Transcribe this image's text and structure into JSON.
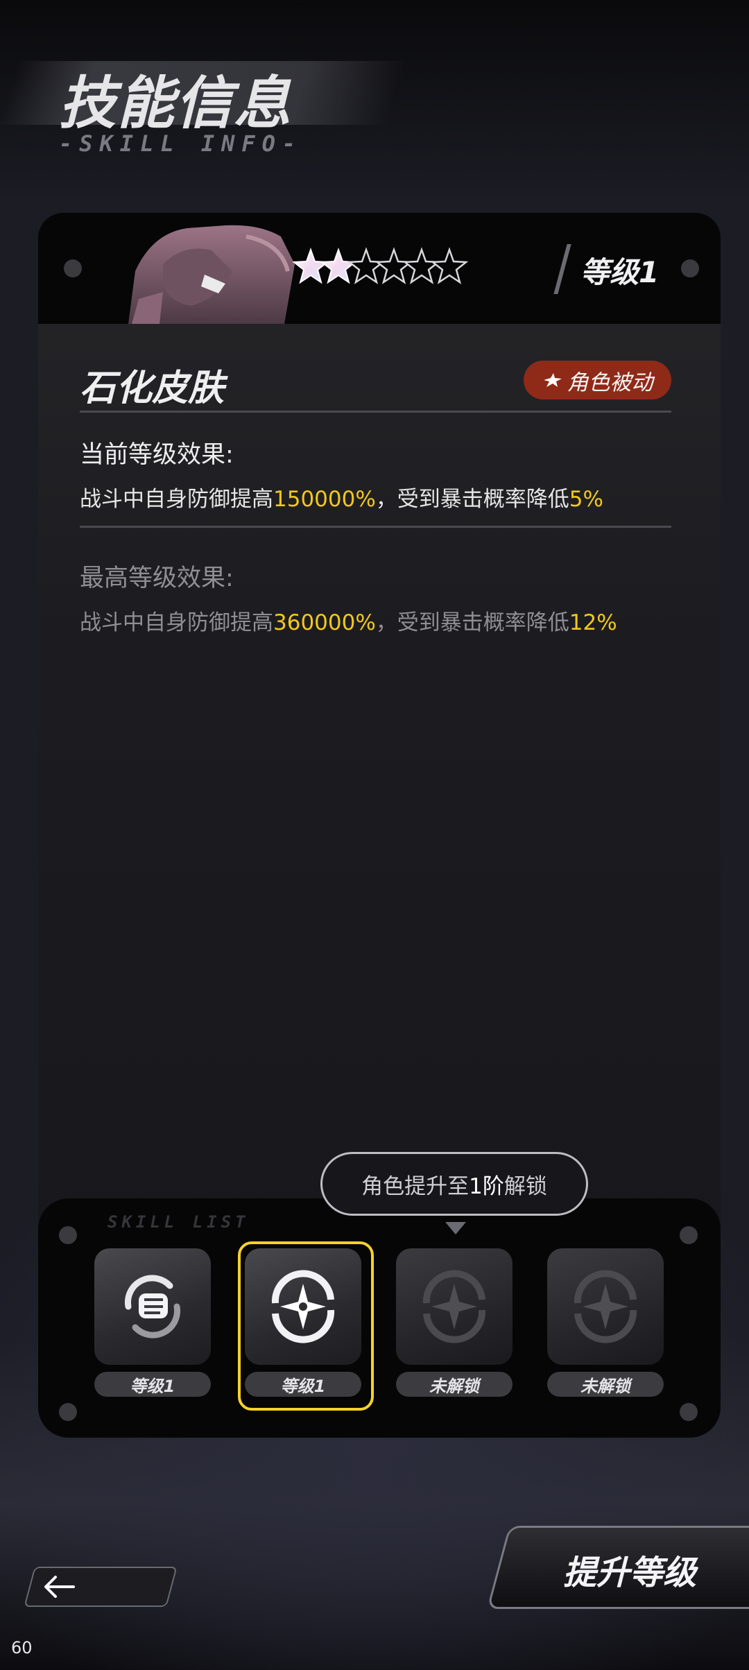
{
  "header": {
    "title": "技能信息",
    "subtitle": "-SKILL INFO-"
  },
  "skill": {
    "level_label": "等级1",
    "stars_filled": 2,
    "stars_total": 6,
    "name": "石化皮肤",
    "type_badge": "角色被动"
  },
  "current_effect": {
    "title": "当前等级效果:",
    "text_before": "战斗中自身防御提高",
    "value1": "150000%",
    "text_middle": "，受到暴击概率降低",
    "value2": "5%"
  },
  "max_effect": {
    "title": "最高等级效果:",
    "text_before": "战斗中自身防御提高",
    "value1": "360000%",
    "text_middle": "，受到暴击概率降低",
    "value2": "12%"
  },
  "unlock_tip": {
    "prefix": "角色提升至",
    "rank": "1阶",
    "suffix": "解锁"
  },
  "panel_label": "SKILL LIST",
  "skill_slots": [
    {
      "label": "等级1",
      "state": "unlocked",
      "icon": "fist-skill-icon"
    },
    {
      "label": "等级1",
      "state": "selected",
      "icon": "star-ring-skill-icon"
    },
    {
      "label": "未解锁",
      "state": "locked",
      "icon": "star-ring-skill-icon"
    },
    {
      "label": "未解锁",
      "state": "locked",
      "icon": "star-ring-skill-icon"
    }
  ],
  "buttons": {
    "upgrade": "提升等级",
    "back_icon": "back-arrow-icon"
  },
  "fps": "60",
  "colors": {
    "highlight": "#f2c81c",
    "badge": "#8f2a18",
    "selected_border": "#f5d22a"
  }
}
